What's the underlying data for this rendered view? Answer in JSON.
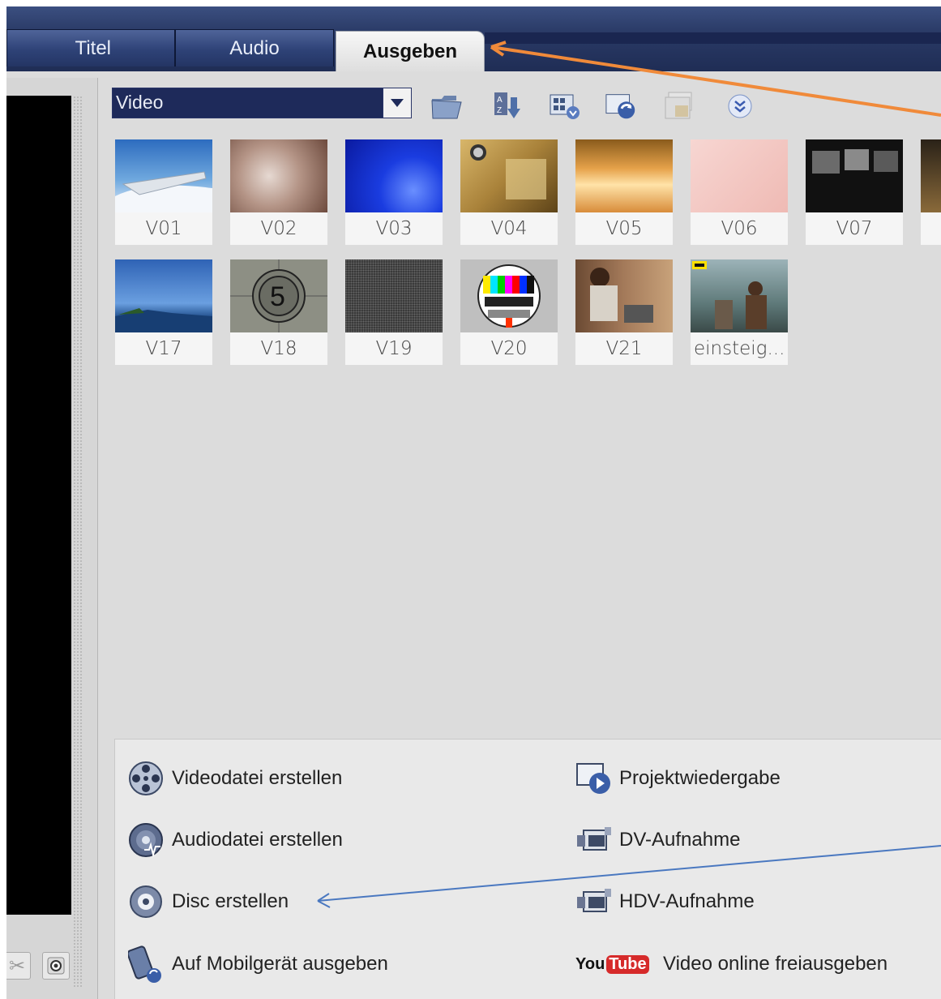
{
  "tabs": [
    {
      "label": "Titel",
      "active": false
    },
    {
      "label": "Audio",
      "active": false
    },
    {
      "label": "Ausgeben",
      "active": true
    }
  ],
  "library": {
    "dropdown_value": "Video",
    "toolbar_icons": [
      "folder-open-icon",
      "sort-az-icon",
      "view-options-icon",
      "capture-video-icon",
      "import-image-icon",
      "expand-more-icon"
    ]
  },
  "thumbnails": [
    {
      "label": "V01"
    },
    {
      "label": "V02"
    },
    {
      "label": "V03"
    },
    {
      "label": "V04"
    },
    {
      "label": "V05"
    },
    {
      "label": "V06"
    },
    {
      "label": "V07"
    },
    {
      "label": "V17"
    },
    {
      "label": "V18"
    },
    {
      "label": "V19"
    },
    {
      "label": "V20"
    },
    {
      "label": "V21"
    },
    {
      "label": "einsteig..."
    }
  ],
  "output": {
    "left": [
      {
        "label": "Videodatei erstellen",
        "icon": "film-reel-icon"
      },
      {
        "label": "Audiodatei erstellen",
        "icon": "audio-disc-icon"
      },
      {
        "label": "Disc erstellen",
        "icon": "disc-icon"
      },
      {
        "label": "Auf Mobilgerät ausgeben",
        "icon": "mobile-device-icon"
      }
    ],
    "right": [
      {
        "label": "Projektwiedergabe",
        "icon": "play-project-icon"
      },
      {
        "label": "DV-Aufnahme",
        "icon": "camcorder-icon"
      },
      {
        "label": "HDV-Aufnahme",
        "icon": "camcorder-icon"
      },
      {
        "label": "Video online freiausgeben",
        "icon": "youtube-icon"
      }
    ],
    "youtube_logo": {
      "you": "You",
      "tube": "Tube"
    }
  },
  "colors": {
    "tabbar": "#2a3a66",
    "arrow_orange": "#f08a3a",
    "arrow_blue": "#4a78c0"
  }
}
